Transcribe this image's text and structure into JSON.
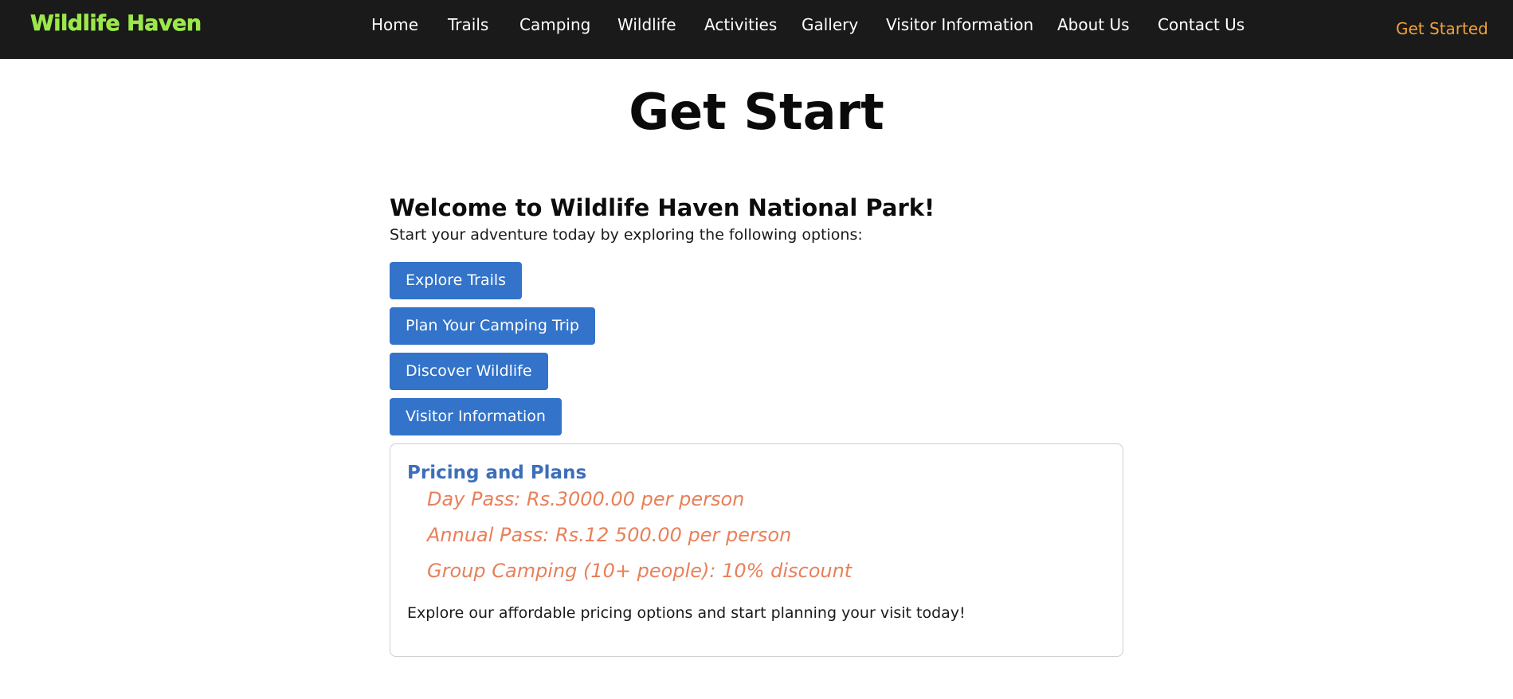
{
  "brand": {
    "name": "Wildlife Haven",
    "color": "#9be84a"
  },
  "nav": {
    "items": [
      {
        "label": "Home"
      },
      {
        "label": "Trails"
      },
      {
        "label": "Camping"
      },
      {
        "label": "Wildlife"
      },
      {
        "label": "Activities"
      },
      {
        "label": "Gallery"
      },
      {
        "label": "Visitor Information"
      },
      {
        "label": "About Us"
      },
      {
        "label": "Contact Us"
      }
    ],
    "cta_label": "Get Started",
    "cta_color": "#f0a13a"
  },
  "main": {
    "title": "Get Start",
    "welcome_heading": "Welcome to Wildlife Haven National Park!",
    "intro_text": "Start your adventure today by exploring the following options:",
    "buttons": [
      {
        "label": "Explore Trails"
      },
      {
        "label": "Plan Your Camping Trip"
      },
      {
        "label": "Discover Wildlife"
      },
      {
        "label": "Visitor Information"
      }
    ],
    "button_color": "#3373c9"
  },
  "pricing": {
    "title": "Pricing and Plans",
    "plans": [
      "Day Pass: Rs.3000.00 per person",
      "Annual Pass: Rs.12 500.00 per person",
      "Group Camping (10+ people): 10% discount"
    ],
    "note": "Explore our affordable pricing options and start planning your visit today!",
    "title_color": "#3c6fba",
    "plan_color": "#e8805a"
  }
}
